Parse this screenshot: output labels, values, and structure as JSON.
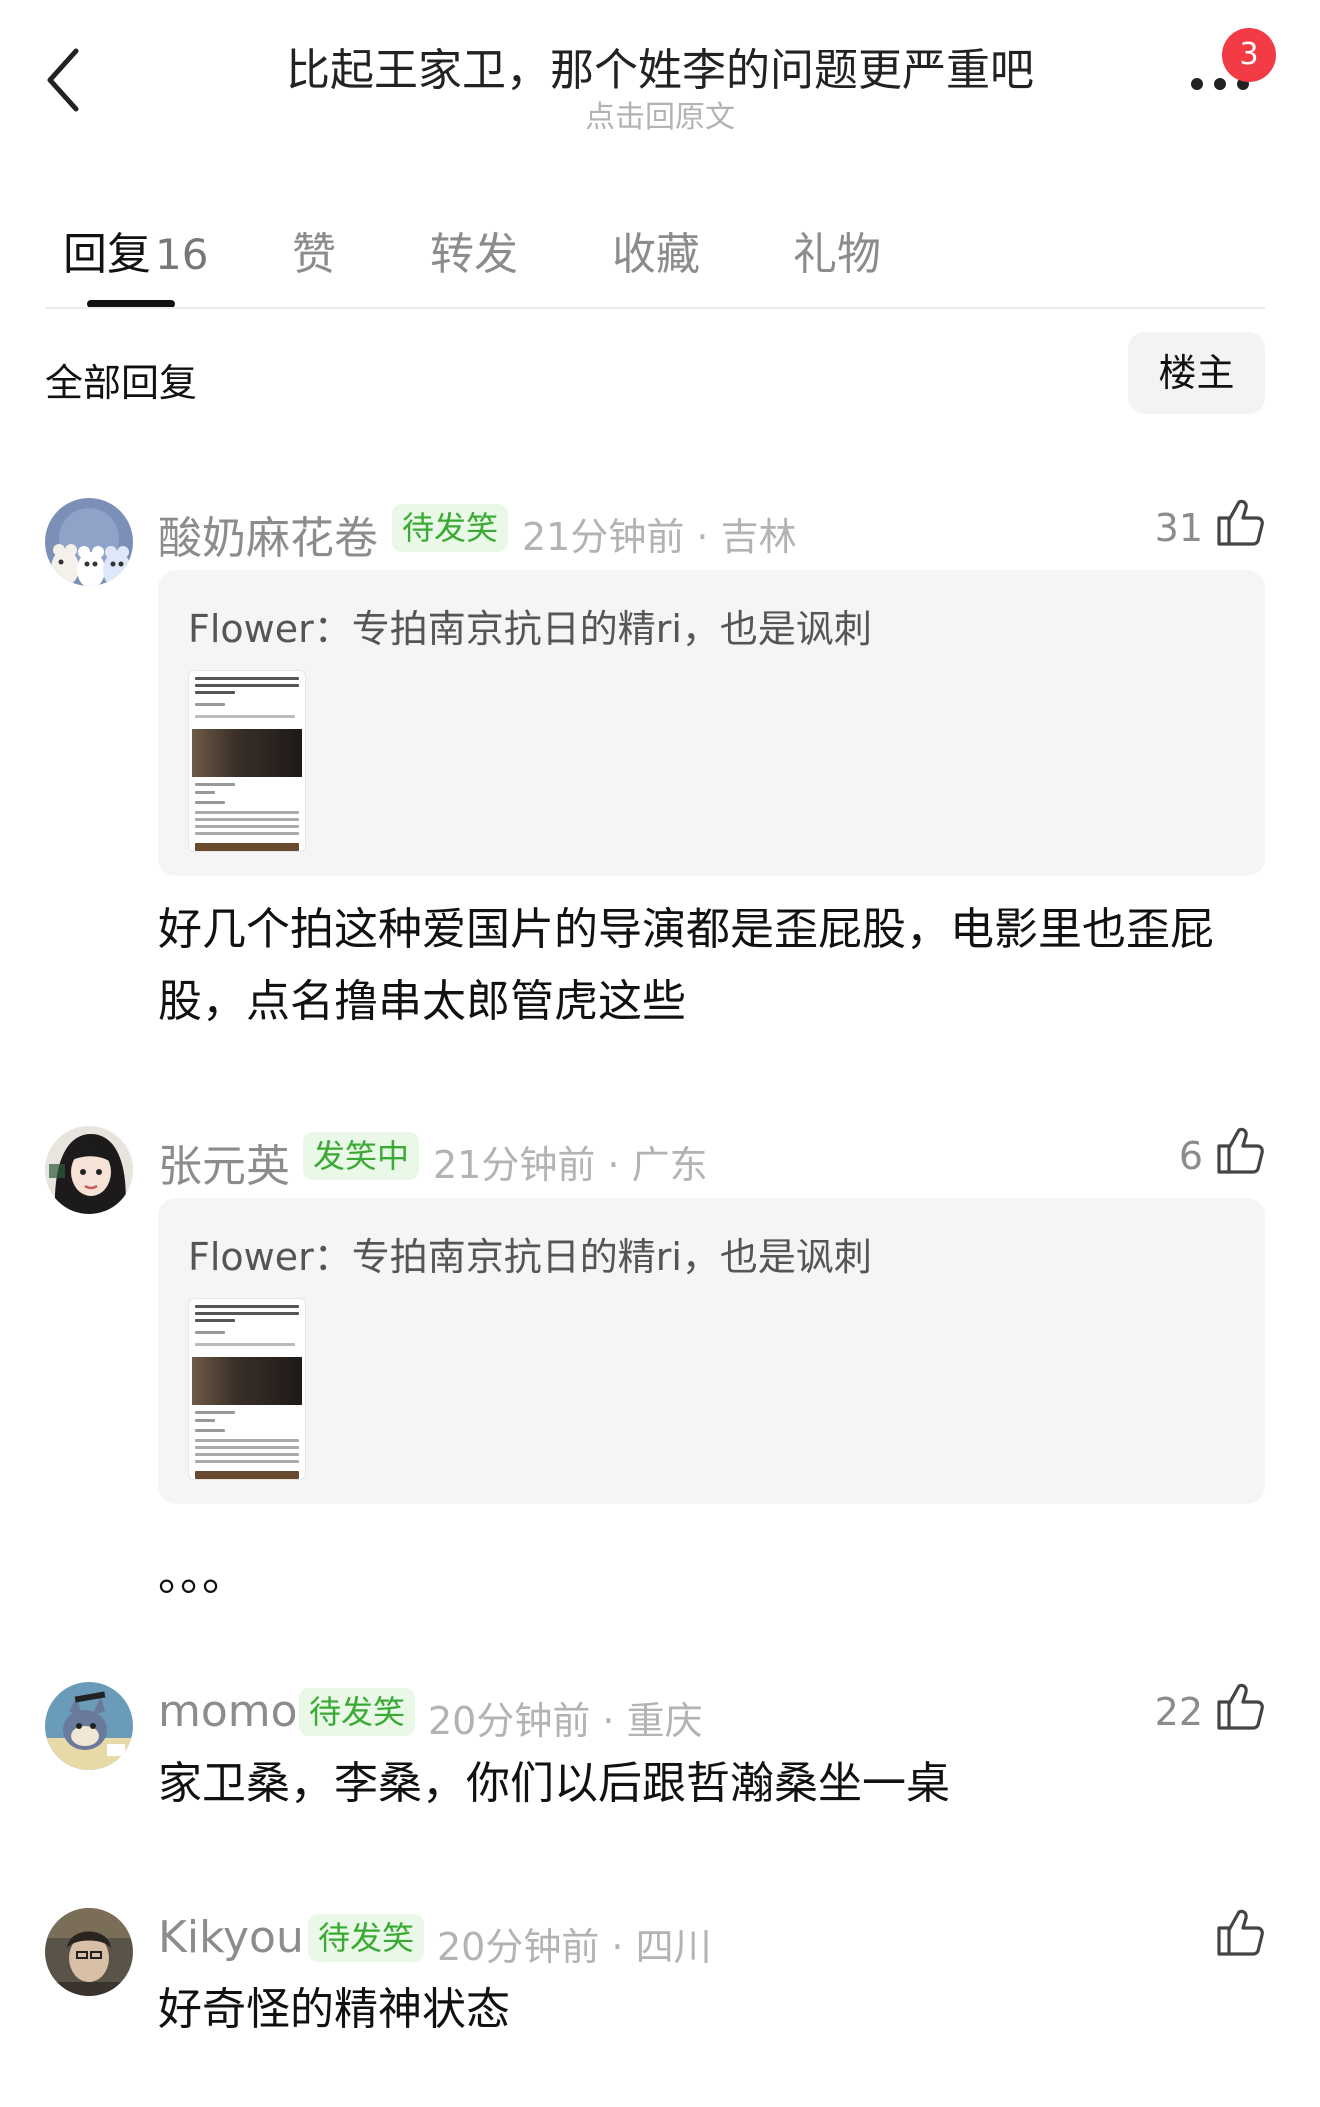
{
  "header": {
    "title": "比起王家卫，那个姓李的问题更严重吧",
    "subtitle": "点击回原文",
    "badge_count": "3",
    "back_icon": "chevron-left-icon",
    "more_icon": "more-dots-icon"
  },
  "tabs": [
    {
      "label": "回复",
      "count": "16",
      "active": true
    },
    {
      "label": "赞"
    },
    {
      "label": "转发"
    },
    {
      "label": "收藏"
    },
    {
      "label": "礼物"
    }
  ],
  "filter": {
    "label": "全部回复",
    "op_button": "楼主"
  },
  "comments": [
    {
      "name": "酸奶麻花卷",
      "tag": "待发笑",
      "meta": "21分钟前 · 吉林",
      "likes": "31",
      "quote": "Flower：专拍南京抗日的精ri，也是讽刺",
      "text": "好几个拍这种爱国片的导演都是歪屁股，电影里也歪屁股，点名撸串太郎管虎这些"
    },
    {
      "name": "张元英",
      "tag": "发笑中",
      "meta": "21分钟前 · 广东",
      "likes": "6",
      "quote": "Flower：专拍南京抗日的精ri，也是讽刺",
      "text": "。。。"
    },
    {
      "name": "momo",
      "tag": "待发笑",
      "meta": "20分钟前 · 重庆",
      "likes": "22",
      "text": "家卫桑，李桑，你们以后跟哲瀚桑坐一桌"
    },
    {
      "name": "Kikyou",
      "tag": "待发笑",
      "meta": "20分钟前 · 四川",
      "likes": "",
      "text": "好奇怪的精神状态"
    }
  ],
  "colors": {
    "tag_green": "#3aaa35",
    "badge_red": "#f23b45",
    "muted_gray": "#b3b3b3"
  }
}
